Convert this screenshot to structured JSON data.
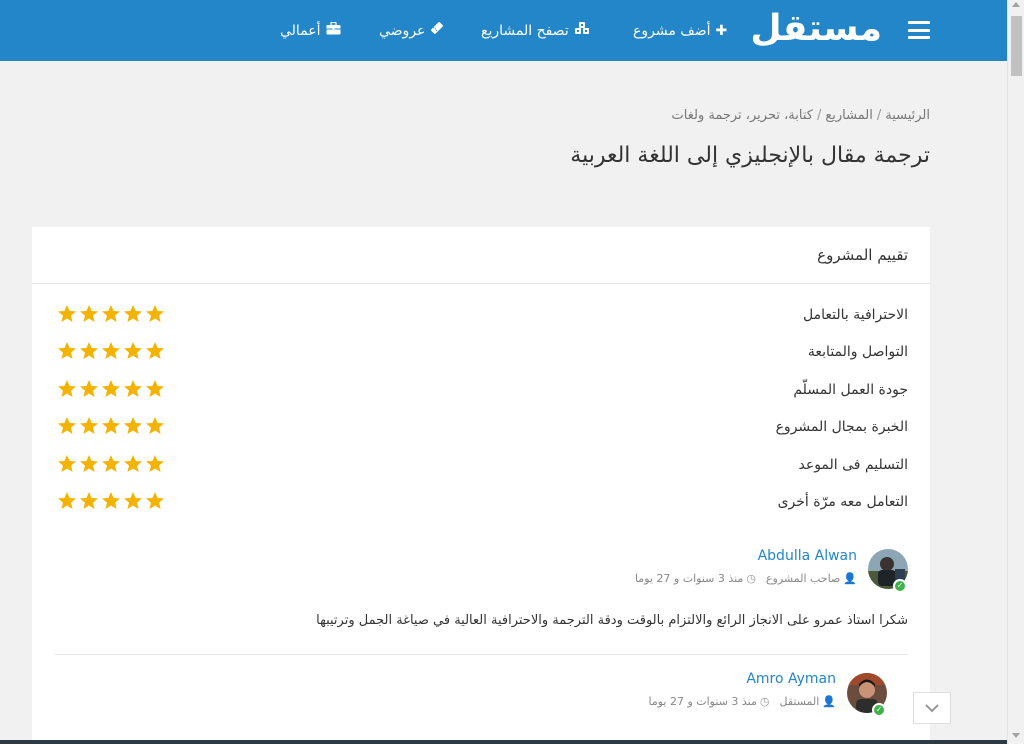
{
  "header": {
    "logo": "مستقل",
    "nav": [
      {
        "label": "أضف مشروع",
        "icon": "plus-icon"
      },
      {
        "label": "تصفح المشاريع",
        "icon": "cubes-icon"
      },
      {
        "label": "عروضي",
        "icon": "ticket-icon"
      },
      {
        "label": "أعمالي",
        "icon": "briefcase-icon"
      }
    ]
  },
  "breadcrumb": {
    "items": [
      "الرئيسية",
      "المشاريع",
      "كتابة، تحرير، ترجمة ولغات"
    ],
    "separator": "/"
  },
  "page_title": "ترجمة مقال بالإنجليزي إلى اللغة العربية",
  "rating_card": {
    "title": "تقييم المشروع",
    "criteria": [
      {
        "label": "الاحترافية بالتعامل",
        "stars": 5
      },
      {
        "label": "التواصل والمتابعة",
        "stars": 5
      },
      {
        "label": "جودة العمل المسلّم",
        "stars": 5
      },
      {
        "label": "الخبرة بمجال المشروع",
        "stars": 5
      },
      {
        "label": "التسليم فى الموعد",
        "stars": 5
      },
      {
        "label": "التعامل معه مرّة أخرى",
        "stars": 5
      }
    ],
    "star_color": "#f5b301"
  },
  "comments": [
    {
      "name": "Abdulla Alwan",
      "role": "صاحب المشروع",
      "time": "منذ 3 سنوات و 27 يوما",
      "text": "شكرا استاذ عمرو على الانجاز الرائع والالتزام بالوقت ودقة الترجمة والاحترافية العالية في صياغة الجمل وترتيبها"
    },
    {
      "name": "Amro Ayman",
      "role": "المستقل",
      "time": "منذ 3 سنوات و 27 يوما"
    }
  ],
  "colors": {
    "brand": "#2386c8",
    "link": "#2386c8",
    "verified": "#3eb24a"
  }
}
